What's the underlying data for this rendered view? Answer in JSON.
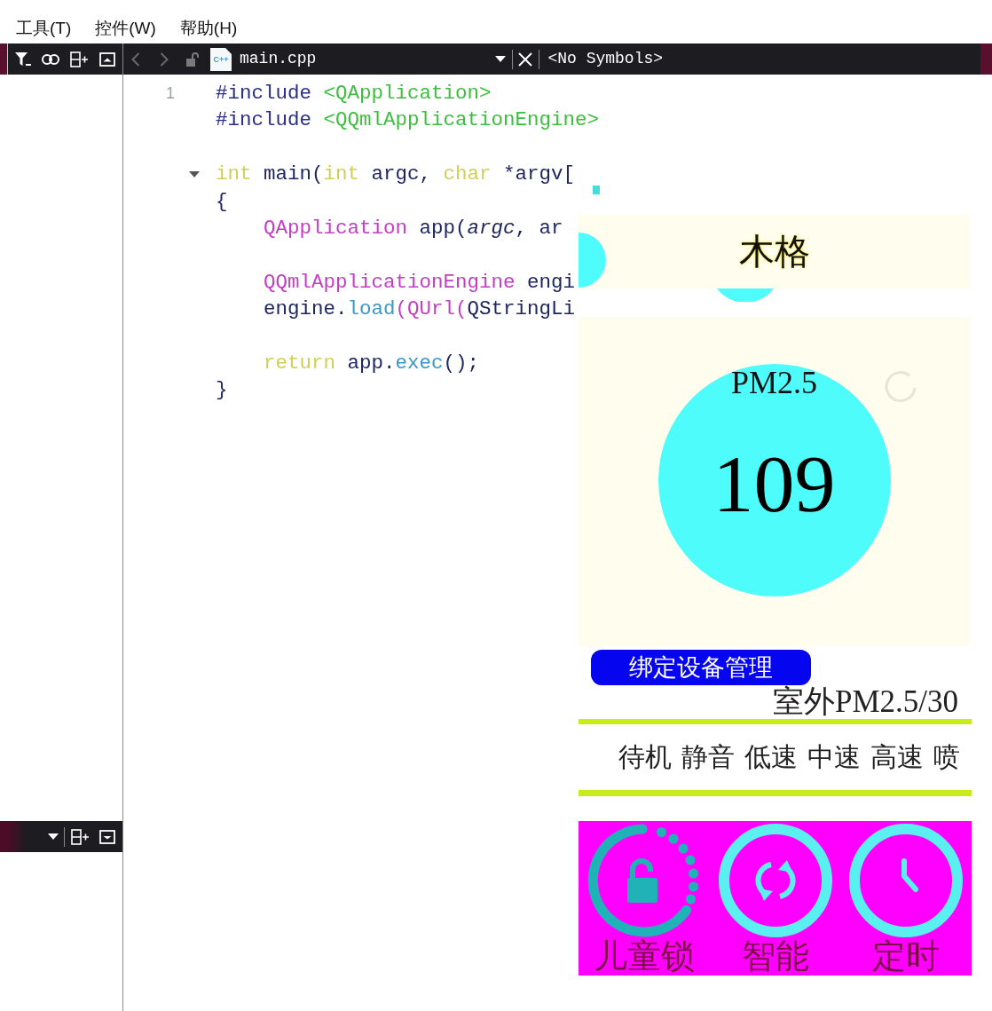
{
  "menu": [
    {
      "label": "工具(T)"
    },
    {
      "label": "控件(W)"
    },
    {
      "label": "帮助(H)"
    }
  ],
  "editor_toolbar": {
    "nav": [
      {
        "kind": "back",
        "disabled": true
      },
      {
        "kind": "forward",
        "disabled": true
      }
    ],
    "file_icon_text": "C++",
    "file_name": "main.cpp",
    "symbols": "<No Symbols>"
  },
  "code": {
    "lines": [
      {
        "kind": "code",
        "number": "1",
        "tokens": [
          {
            "kind": "directive",
            "text": "#include "
          },
          {
            "kind": "header",
            "text": "<QApplication>"
          }
        ]
      },
      {
        "kind": "code",
        "tokens": [
          {
            "kind": "directive",
            "text": "#include "
          },
          {
            "kind": "header",
            "text": "<QQmlApplicationEngine>"
          }
        ]
      },
      {
        "kind": "blank"
      },
      {
        "kind": "code",
        "fold": {
          "expanded": true
        },
        "tokens": [
          {
            "kind": "keyword",
            "text": "int"
          },
          {
            "kind": "plain",
            "text": " main("
          },
          {
            "kind": "keyword",
            "text": "int"
          },
          {
            "kind": "plain",
            "text": " argc, "
          },
          {
            "kind": "keyword",
            "text": "char"
          },
          {
            "kind": "plain",
            "text": " *argv["
          }
        ]
      },
      {
        "kind": "code",
        "tokens": [
          {
            "kind": "plain",
            "text": "{"
          }
        ]
      },
      {
        "kind": "block",
        "children": [
          {
            "kind": "code",
            "tokens": [
              {
                "kind": "type",
                "text": "QApplication"
              },
              {
                "kind": "plain",
                "text": " app("
              },
              {
                "kind": "param",
                "text": "argc"
              },
              {
                "kind": "plain",
                "text": ", ar"
              }
            ]
          },
          {
            "kind": "blank"
          },
          {
            "kind": "code",
            "tokens": [
              {
                "kind": "type",
                "text": "QQmlApplicationEngine"
              },
              {
                "kind": "plain",
                "text": " engi"
              }
            ]
          },
          {
            "kind": "code",
            "tokens": [
              {
                "kind": "plain",
                "text": "engine."
              },
              {
                "kind": "call",
                "text": "load"
              },
              {
                "kind": "type",
                "text": "(QUrl("
              },
              {
                "kind": "plain",
                "text": "QStringLi"
              }
            ]
          },
          {
            "kind": "blank"
          },
          {
            "kind": "code",
            "tokens": [
              {
                "kind": "keyword",
                "text": "return"
              },
              {
                "kind": "plain",
                "text": " app."
              },
              {
                "kind": "call",
                "text": "exec"
              },
              {
                "kind": "plain",
                "text": "();"
              }
            ]
          }
        ]
      },
      {
        "kind": "code",
        "tokens": [
          {
            "kind": "plain",
            "text": "}"
          }
        ]
      }
    ]
  },
  "app": {
    "title": "木格",
    "pm_label": "PM2.5",
    "pm_value": "109",
    "bind_button": "绑定设备管理",
    "outdoor": "室外PM2.5/30",
    "modes": [
      {
        "label": "待机"
      },
      {
        "label": "静音"
      },
      {
        "label": "低速"
      },
      {
        "label": "中速"
      },
      {
        "label": "高速"
      },
      {
        "label": "喷"
      }
    ],
    "controls": [
      {
        "kind": "lock",
        "label": "儿童锁"
      },
      {
        "kind": "smart",
        "label": "智能"
      },
      {
        "kind": "timer",
        "label": "定时"
      }
    ]
  }
}
